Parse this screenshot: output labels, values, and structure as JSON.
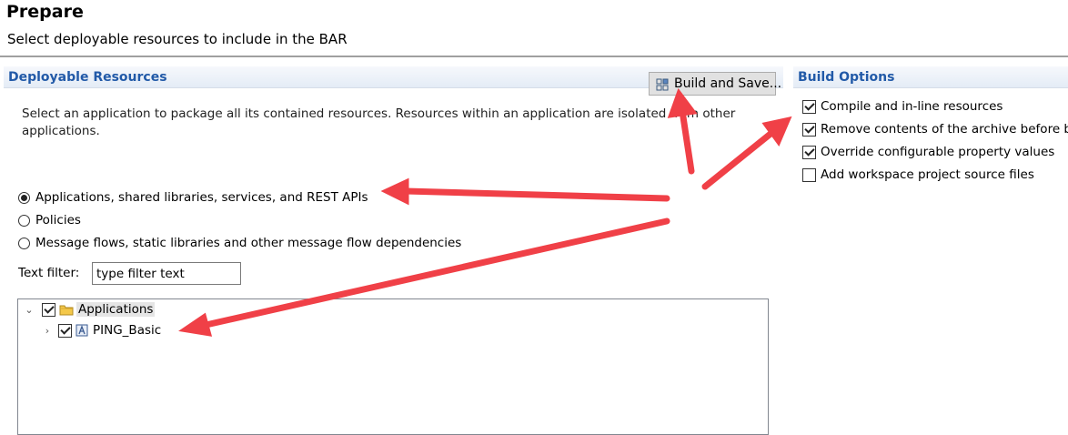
{
  "header": {
    "title": "Prepare",
    "subtitle": "Select deployable resources to include in the BAR"
  },
  "deployable": {
    "section_title": "Deployable Resources",
    "build_button_label": "Build and Save...",
    "description": "Select an application to package all its contained resources. Resources within an application are isolated from other applications.",
    "radios": [
      {
        "label": "Applications, shared libraries, services, and REST APIs",
        "selected": true
      },
      {
        "label": "Policies",
        "selected": false
      },
      {
        "label": "Message flows, static libraries and other message flow dependencies",
        "selected": false
      }
    ],
    "filter_label": "Text filter:",
    "filter_value": "type filter text",
    "tree": [
      {
        "label": "Applications",
        "checked": true,
        "expanded": true,
        "icon": "folder-icon"
      },
      {
        "label": "PING_Basic",
        "checked": true,
        "expanded": false,
        "icon": "application-icon"
      }
    ]
  },
  "build_options": {
    "section_title": "Build Options",
    "options": [
      {
        "label": "Compile and in-line resources",
        "checked": true
      },
      {
        "label": "Remove contents of the archive before b",
        "checked": true
      },
      {
        "label": "Override configurable property values",
        "checked": true
      },
      {
        "label": "Add workspace project source files",
        "checked": false
      }
    ]
  },
  "annotation_color": "#f04047"
}
